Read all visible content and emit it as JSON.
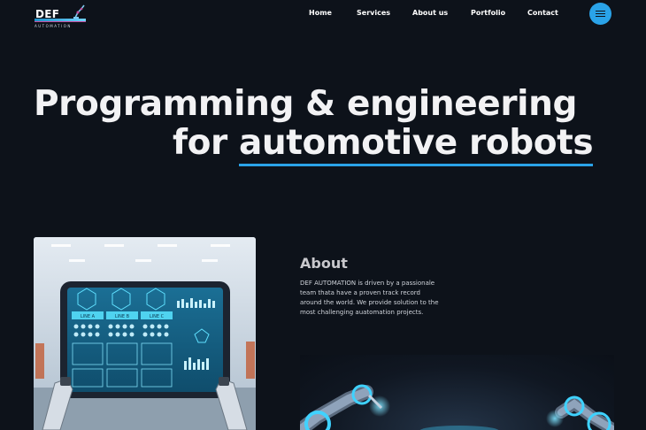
{
  "logo": {
    "name": "DEF",
    "tagline": "AUTOMATION"
  },
  "nav": {
    "items": [
      "Home",
      "Services",
      "About us",
      "Portfolio",
      "Contact"
    ]
  },
  "hero": {
    "line1": "Programming & engineering",
    "line2_prefix": "for ",
    "line2_highlight": "automotive robots"
  },
  "about": {
    "title": "About",
    "text": "DEF AUTOMATION is driven by a passionale team thata have a proven track record around the world. We provide solution to the most challenging auatomation projects."
  },
  "screen": {
    "lines": [
      "LINE A",
      "LINE B",
      "LINE C"
    ]
  },
  "colors": {
    "accent": "#2aa3e8",
    "background": "#0d121a"
  }
}
